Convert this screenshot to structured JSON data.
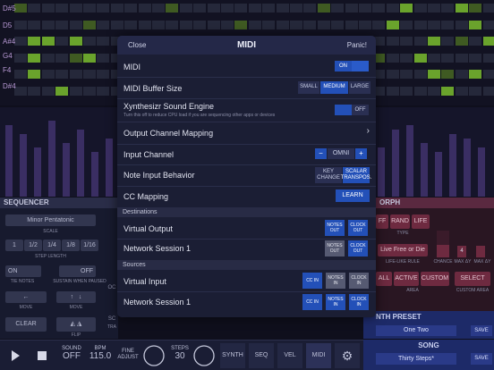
{
  "background": {
    "note_labels": [
      "D#5",
      "D5",
      "A#4",
      "G4",
      "F4",
      "D#4"
    ],
    "sequencer_header": "SEQUENCER",
    "morph_header": "ORPH",
    "scale_value": "Minor Pentatonic",
    "scale_label": "SCALE",
    "step_lengths": [
      "1",
      "1/2",
      "1/4",
      "1/8",
      "1/16"
    ],
    "step_length_label": "STEP LENGTH",
    "tie_notes_value": "ON",
    "tie_notes_label": "TIE NOTES",
    "sustain_value": "OFF",
    "sustain_label": "SUSTAIN WHEN PAUSED",
    "move_left_label": "MOVE",
    "move_right_label": "MOVE",
    "clear_label": "CLEAR",
    "flip_label": "FLIP",
    "oct_label": "OC",
    "sca_label": "SC",
    "tra_label": "TRA",
    "morph": {
      "buttons_top": [
        "FF",
        "RAND",
        "LIFE"
      ],
      "type_label": "TYPE",
      "life_rule": "Live Free or Die",
      "life_rule_label": "LIFE-LIKE RULE",
      "chance_label": "CHANCE",
      "max_dx_label": "MAX ΔY",
      "max_dy_label": "MAX ΔY",
      "max_value": "4",
      "area_buttons": [
        "ALL",
        "ACTIVE",
        "CUSTOM"
      ],
      "area_label": "AREA",
      "custom_area_button": "SELECT",
      "custom_area_label": "CUSTOM AREA"
    },
    "synth_preset": {
      "header": "NTH PRESET",
      "name": "One Two",
      "save": "SAVE"
    },
    "song": {
      "header": "SONG",
      "name": "Thirty Steps*",
      "save": "SAVE"
    },
    "toolbar": {
      "sound_label": "SOUND",
      "sound_value": "OFF",
      "bpm_label": "BPM",
      "bpm_value": "115.0",
      "fine_adjust_label": "FINE ADJUST",
      "steps_label": "STEPS",
      "steps_value": "30",
      "tabs": [
        "SYNTH",
        "SEQ",
        "VEL",
        "MIDI"
      ]
    }
  },
  "modal": {
    "close": "Close",
    "title": "MIDI",
    "panic": "Panic!",
    "midi_label": "MIDI",
    "midi_toggle": "ON",
    "buffer_label": "MIDI Buffer Size",
    "buffer_options": [
      "SMALL",
      "MEDIUM",
      "LARGE"
    ],
    "buffer_selected": "MEDIUM",
    "engine_label": "Xynthesizr Sound Engine",
    "engine_sub": "Turn this off to reduce CPU load if you are sequencing other apps or devices",
    "engine_toggle": "OFF",
    "output_mapping_label": "Output Channel Mapping",
    "input_channel_label": "Input Channel",
    "input_minus": "−",
    "input_value": "OMNI",
    "input_plus": "+",
    "note_behavior_label": "Note Input Behavior",
    "note_behavior_opt1": "KEY CHANGE",
    "note_behavior_opt2": "SCALAR TRANSPOS.",
    "cc_mapping_label": "CC Mapping",
    "cc_learn": "LEARN",
    "destinations_header": "Destinations",
    "destinations": [
      {
        "name": "Virtual Output",
        "buttons": [
          "NOTES OUT",
          "CLOCK OUT"
        ]
      },
      {
        "name": "Network Session 1",
        "buttons": [
          "NOTES OUT",
          "CLOCK OUT"
        ]
      }
    ],
    "sources_header": "Sources",
    "sources": [
      {
        "name": "Virtual Input",
        "buttons": [
          "CC IN",
          "NOTES IN",
          "CLOCK IN"
        ]
      },
      {
        "name": "Network Session 1",
        "buttons": [
          "CC IN",
          "NOTES IN",
          "CLOCK IN"
        ]
      }
    ]
  },
  "colors": {
    "accent_blue": "#2350b8",
    "grid_on": "#6aa32c",
    "morph_red": "#6e2a40",
    "preset_blue": "#1d2a68"
  }
}
